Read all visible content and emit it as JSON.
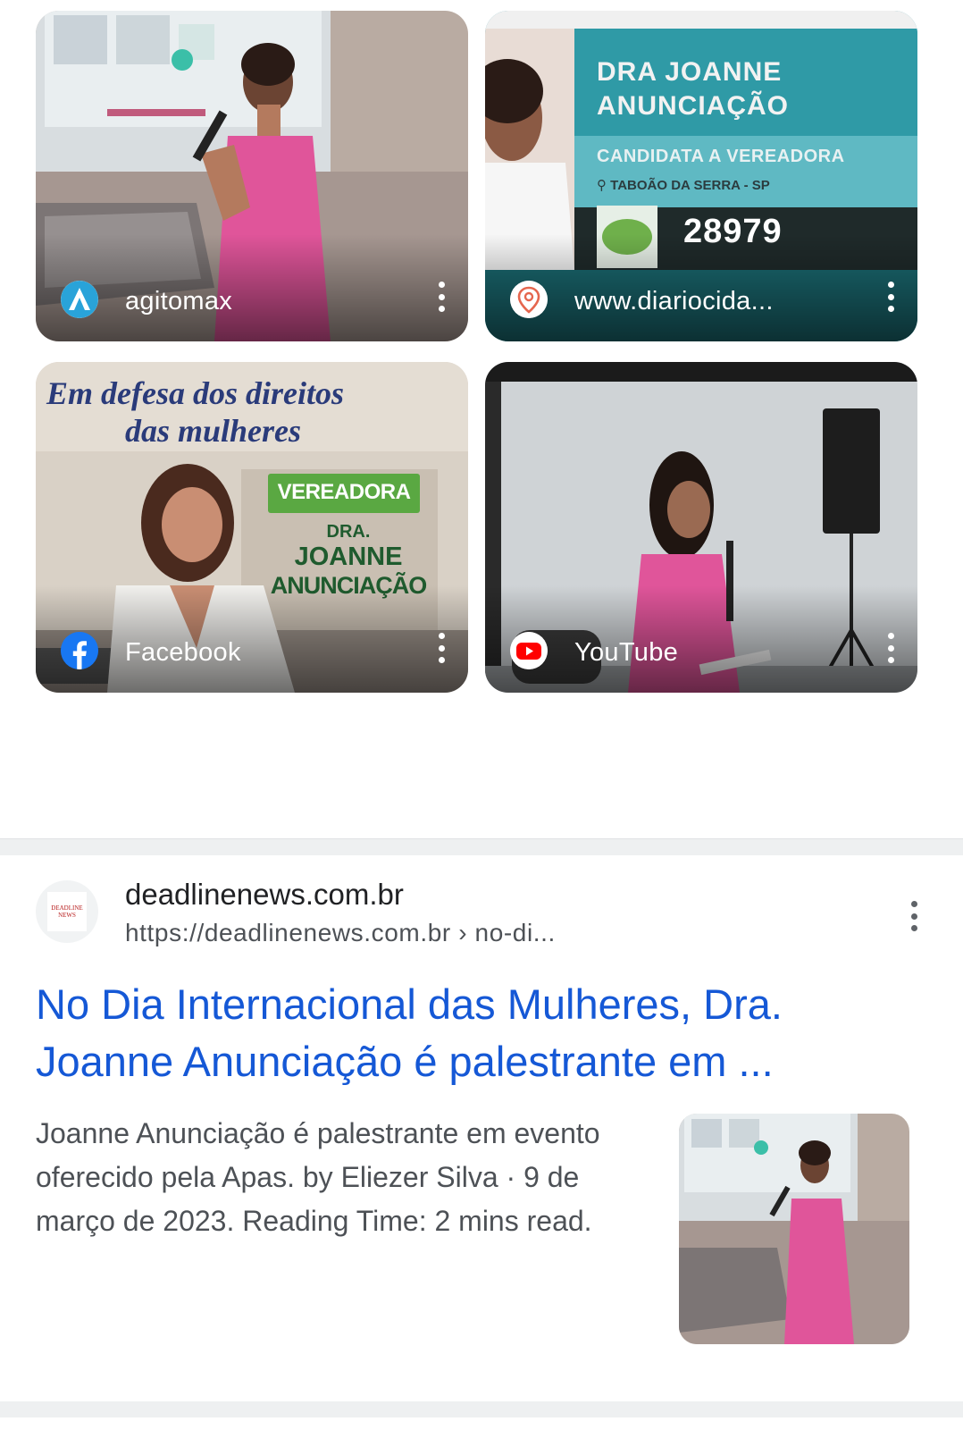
{
  "image_results": [
    {
      "source": "agitomax",
      "icon": "agitomax-logo-icon"
    },
    {
      "source": "www.diariocida...",
      "icon": "map-pin-icon",
      "poster": {
        "line1": "DRA JOANNE",
        "line2": "ANUNCIAÇÃO",
        "subtitle": "CANDIDATA A VEREADORA",
        "location": "TABOÃO DA SERRA - SP",
        "number": "28979"
      }
    },
    {
      "source": "Facebook",
      "icon": "facebook-icon",
      "poster": {
        "heading1": "Em defesa dos direitos",
        "heading2": "das mulheres",
        "badge": "VEREADORA",
        "name1": "DRA.",
        "name2": "JOANNE",
        "name3": "ANUNCIAÇÃO"
      }
    },
    {
      "source": "YouTube",
      "icon": "youtube-icon"
    }
  ],
  "result": {
    "site_name": "deadlinenews.com.br",
    "url": "https://deadlinenews.com.br › no-di...",
    "favicon_text": "DEADLINE NEWS",
    "title": "No Dia Internacional das Mulheres, Dra. Joanne Anunciação é palestrante em ...",
    "snippet": "Joanne Anunciação é palestrante em evento oferecido pela Apas. by Eliezer Silva · 9 de março de 2023. Reading Time: 2 mins read."
  },
  "colors": {
    "link": "#1558d6",
    "pink_dress": "#e0559a",
    "poster_teal": "#2a8f9b",
    "poster_green": "#5aa842"
  }
}
